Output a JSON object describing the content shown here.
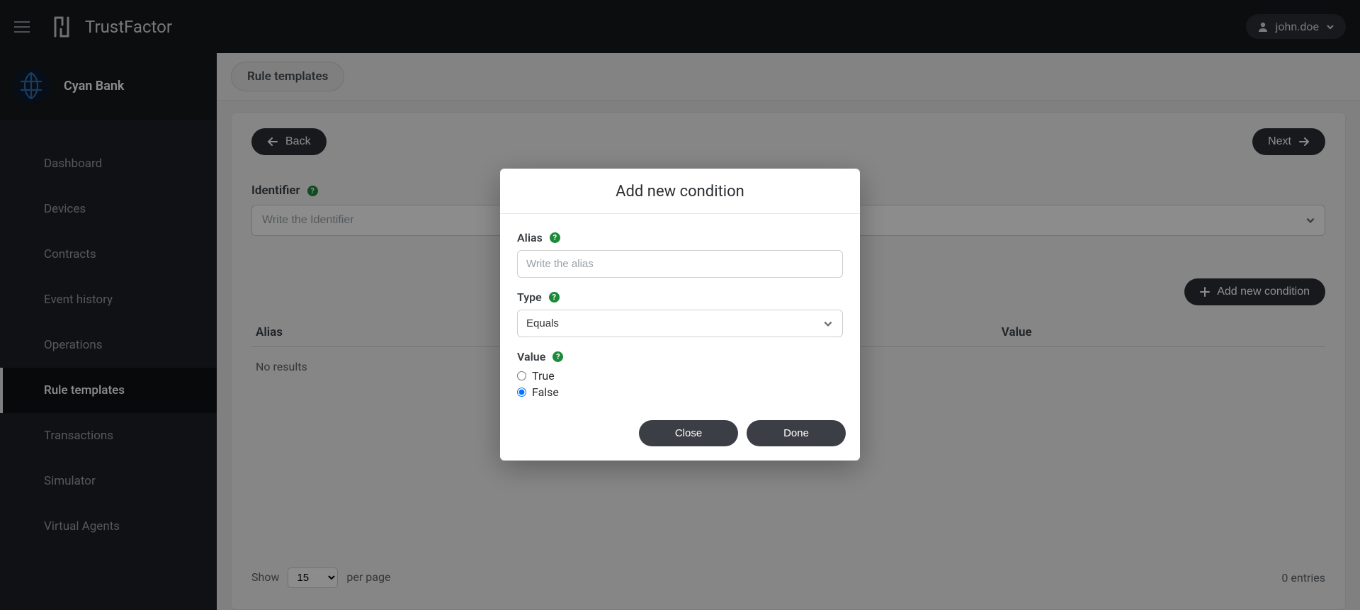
{
  "header": {
    "brand": "TrustFactor",
    "user": "john.doe"
  },
  "sidebar": {
    "org_name": "Cyan Bank",
    "items": [
      {
        "label": "Dashboard",
        "active": false
      },
      {
        "label": "Devices",
        "active": false
      },
      {
        "label": "Contracts",
        "active": false
      },
      {
        "label": "Event history",
        "active": false
      },
      {
        "label": "Operations",
        "active": false
      },
      {
        "label": "Rule templates",
        "active": true
      },
      {
        "label": "Transactions",
        "active": false
      },
      {
        "label": "Simulator",
        "active": false
      },
      {
        "label": "Virtual Agents",
        "active": false
      }
    ]
  },
  "breadcrumb": {
    "label": "Rule templates"
  },
  "panel": {
    "back_label": "Back",
    "next_label": "Next",
    "identifier_label": "Identifier",
    "identifier_placeholder": "Write the Identifier",
    "add_condition_label": "Add new condition",
    "table": {
      "col_alias": "Alias",
      "col_value": "Value",
      "no_results": "No results"
    },
    "pagination": {
      "show_label": "Show",
      "per_page_label": "per page",
      "page_size": "15",
      "entries_label": "0 entries"
    }
  },
  "modal": {
    "title": "Add new condition",
    "alias_label": "Alias",
    "alias_placeholder": "Write the alias",
    "type_label": "Type",
    "type_value": "Equals",
    "value_label": "Value",
    "radio_true": "True",
    "radio_false": "False",
    "selected_value": "False",
    "close_label": "Close",
    "done_label": "Done"
  }
}
